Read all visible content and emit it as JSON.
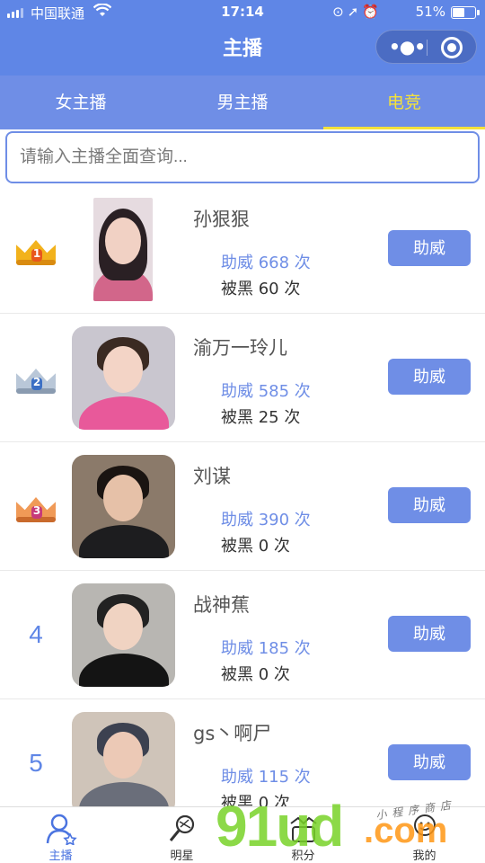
{
  "status_bar": {
    "carrier": "中国联通",
    "time": "17:14",
    "battery": "51%",
    "battery_level": 0.51
  },
  "header": {
    "title": "主播",
    "more_icon": "more-dots-icon",
    "close_icon": "target-circle-icon"
  },
  "tabs": [
    {
      "label": "女主播",
      "active": false
    },
    {
      "label": "男主播",
      "active": false
    },
    {
      "label": "电竞",
      "active": true
    }
  ],
  "search": {
    "placeholder": "请输入主播全面查询...",
    "value": ""
  },
  "streamers": [
    {
      "rank": "1",
      "crown": "gold",
      "name": "孙狠狠",
      "cheer": "助威 668 次",
      "black": "被黑 60 次",
      "button": "助威"
    },
    {
      "rank": "2",
      "crown": "silver",
      "name": "渝万一玲儿",
      "cheer": "助威 585 次",
      "black": "被黑 25 次",
      "button": "助威"
    },
    {
      "rank": "3",
      "crown": "bronze",
      "name": "刘谋",
      "cheer": "助威 390 次",
      "black": "被黑 0 次",
      "button": "助威"
    },
    {
      "rank": "4",
      "crown": "",
      "name": "战神蕉",
      "cheer": "助威 185 次",
      "black": "被黑 0 次",
      "button": "助威"
    },
    {
      "rank": "5",
      "crown": "",
      "name": "gs丶啊尸",
      "cheer": "助威 115 次",
      "black": "被黑 0 次",
      "button": "助威"
    }
  ],
  "tabbar": [
    {
      "label": "主播",
      "icon": "person-star-icon",
      "active": true
    },
    {
      "label": "明星",
      "icon": "microphone-icon",
      "active": false
    },
    {
      "label": "积分",
      "icon": "points-icon",
      "active": false
    },
    {
      "label": "我的",
      "icon": "smile-user-icon",
      "active": false
    }
  ],
  "watermark": {
    "brand": "91ud",
    "tld": ".com",
    "caption": "小程序商店"
  },
  "colors": {
    "primary": "#5f86e6",
    "tab_bar": "#6f8ee6",
    "active_tab": "#f4e23b",
    "button": "#6f8ee6"
  }
}
